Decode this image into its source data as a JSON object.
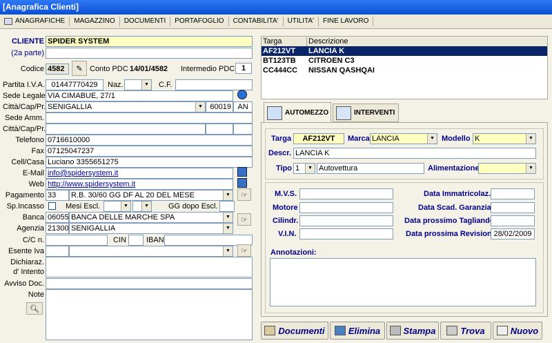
{
  "window": {
    "title": "[Anagrafica Clienti]"
  },
  "menu": [
    "ANAGRAFICHE",
    "MAGAZZINO",
    "DOCUMENTI",
    "PORTAFOGLIO",
    "CONTABILITA'",
    "UTILITA'",
    "FINE LAVORO"
  ],
  "client": {
    "cliente_label": "CLIENTE",
    "cliente_value": "SPIDER SYSTEM",
    "parte2_label": "(2a parte)",
    "parte2_value": "",
    "codice_label": "Codice",
    "codice_value": "4582",
    "conto_pdc_label": "Conto PDC",
    "conto_pdc_value": "14/01/4582",
    "intermedio_label": "Intermedio PDC",
    "intermedio_value": "1",
    "piva_label": "Partita I.V.A.",
    "piva_value": "01447770429",
    "naz_label": "Naz.",
    "naz_value": "",
    "cf_label": "C.F.",
    "cf_value": "",
    "sede_legale_label": "Sede Legale",
    "sede_legale_value": "VIA CIMABUE, 27/1",
    "citta1_label": "Città/Cap/Pr.",
    "citta1_value": "SENIGALLIA",
    "cap1_value": "60019",
    "pr1_value": "AN",
    "sede_amm_label": "Sede Amm.",
    "sede_amm_value": "",
    "citta2_label": "Città/Cap/Pr.",
    "citta2_value": "",
    "telefono_label": "Telefono",
    "telefono_value": "0716610000",
    "fax_label": "Fax",
    "fax_value": "07125047237",
    "cell_label": "Cell/Casa",
    "cell_value": "Luciano 3355651275",
    "email_label": "E-Mail",
    "email_value": "info@spidersystem.it",
    "web_label": "Web",
    "web_value": "http://www.spidersystem.it",
    "pagamento_label": "Pagamento",
    "pagamento_code": "33",
    "pagamento_value": "R.B. 30/60 GG DF AL 20 DEL MESE",
    "incasso_label": "Sp.Incasso",
    "mesi_escl_label": "Mesi Escl.",
    "gg_dopo_label": "GG dopo Escl.",
    "banca_label": "Banca",
    "banca_code": "06055",
    "banca_value": "BANCA DELLE MARCHE SPA",
    "agenzia_label": "Agenzia",
    "agenzia_code": "21300",
    "agenzia_value": "SENIGALLIA",
    "cc_label": "C/C n.",
    "cin_label": "CIN",
    "iban_label": "IBAN",
    "esente_label": "Esente Iva",
    "dichiaraz_label1": "Dichiaraz.",
    "dichiaraz_label2": "d' Intento",
    "avviso_label": "Avviso Doc.",
    "note_label": "Note"
  },
  "vehicles": {
    "headers": [
      "Targa",
      "Descrizione"
    ],
    "rows": [
      [
        "AF212VT",
        "LANCIA K"
      ],
      [
        "BT123TB",
        "CITROEN C3"
      ],
      [
        "CC444CC",
        "NISSAN QASHQAI"
      ]
    ]
  },
  "tabs": {
    "automezzo": "AUTOMEZZO",
    "interventi": "INTERVENTI"
  },
  "automezzo": {
    "targa_label": "Targa",
    "targa_value": "AF212VT",
    "marca_label": "Marca",
    "marca_value": "LANCIA",
    "modello_label": "Modello",
    "modello_value": "K",
    "descr_label": "Descr.",
    "descr_value": "LANCIA K",
    "tipo_label": "Tipo",
    "tipo_code": "1",
    "tipo_value": "Autovettura",
    "alim_label": "Alimentazione",
    "alim_value": "",
    "mvs_label": "M.V.S.",
    "motore_label": "Motore",
    "cilindr_label": "Cilindr.",
    "vin_label": "V.I.N.",
    "immatricolaz_label": "Data Immatricolaz.",
    "scad_garanzia_label": "Data Scad. Garanzia",
    "tagliando_label": "Data prossimo Tagliando",
    "revisione_label": "Data prossima Revisione",
    "revisione_value": "28/02/2009",
    "annotazioni_label": "Annotazioni:"
  },
  "buttons": {
    "documenti": "Documenti",
    "elimina": "Elimina",
    "stampa": "Stampa",
    "trova": "Trova",
    "nuovo": "Nuovo"
  }
}
